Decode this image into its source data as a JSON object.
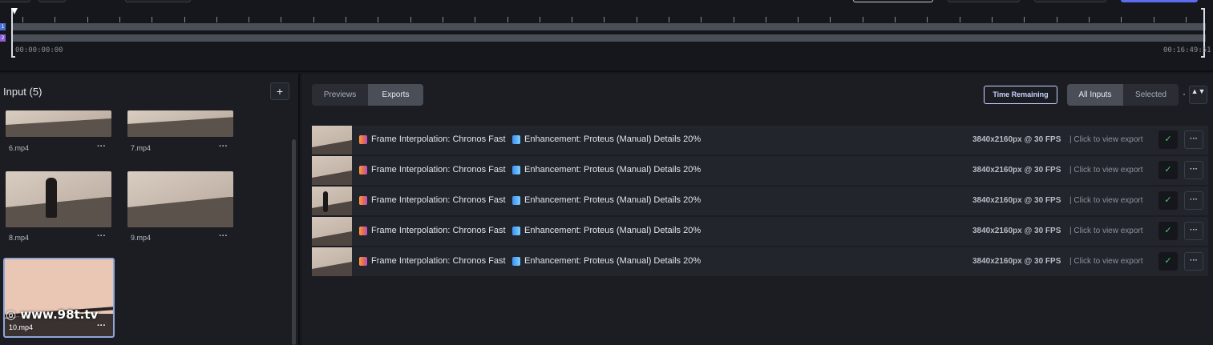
{
  "timeline": {
    "start_time": "00:00:00:00",
    "end_time": "00:16:49:51",
    "tracks": [
      "1",
      "2"
    ],
    "track_colors": [
      "#4a6fd6",
      "#8a5cd6"
    ]
  },
  "input_panel": {
    "title": "Input (5)",
    "add_label": "+",
    "more_label": "···",
    "items": [
      {
        "name": "6.mp4"
      },
      {
        "name": "7.mp4"
      },
      {
        "name": "8.mp4"
      },
      {
        "name": "9.mp4"
      },
      {
        "name": "10.mp4",
        "selected": true
      }
    ]
  },
  "watermark": "www.98t.tv",
  "watermark_icon": "globe-icon",
  "exports_panel": {
    "tabs": [
      {
        "label": "Previews",
        "active": false
      },
      {
        "label": "Exports",
        "active": true
      }
    ],
    "time_remaining_label": "Time Remaining",
    "filter_tabs": [
      {
        "label": "All Inputs",
        "active": true
      },
      {
        "label": "Selected",
        "active": false
      }
    ],
    "sort_label": "▲▼",
    "rows": [
      {
        "model1": "Frame Interpolation: Chronos Fast",
        "model2": "Enhancement: Proteus (Manual) Details 20%",
        "resolution": "3840x2160px @ 30 FPS",
        "action": "| Click to view export",
        "check": "✓",
        "more": "···"
      },
      {
        "model1": "Frame Interpolation: Chronos Fast",
        "model2": "Enhancement: Proteus (Manual) Details 20%",
        "resolution": "3840x2160px @ 30 FPS",
        "action": "| Click to view export",
        "check": "✓",
        "more": "···"
      },
      {
        "model1": "Frame Interpolation: Chronos Fast",
        "model2": "Enhancement: Proteus (Manual) Details 20%",
        "resolution": "3840x2160px @ 30 FPS",
        "action": "| Click to view export",
        "check": "✓",
        "more": "···"
      },
      {
        "model1": "Frame Interpolation: Chronos Fast",
        "model2": "Enhancement: Proteus (Manual) Details 20%",
        "resolution": "3840x2160px @ 30 FPS",
        "action": "| Click to view export",
        "check": "✓",
        "more": "···"
      },
      {
        "model1": "Frame Interpolation: Chronos Fast",
        "model2": "Enhancement: Proteus (Manual) Details 20%",
        "resolution": "3840x2160px @ 30 FPS",
        "action": "| Click to view export",
        "check": "✓",
        "more": "···"
      }
    ],
    "icons": {
      "interpolation": "frame-interpolation-icon",
      "enhancement": "enhancement-icon"
    },
    "accent_color": "#c8d4ff",
    "check_color": "#4ec95f"
  }
}
